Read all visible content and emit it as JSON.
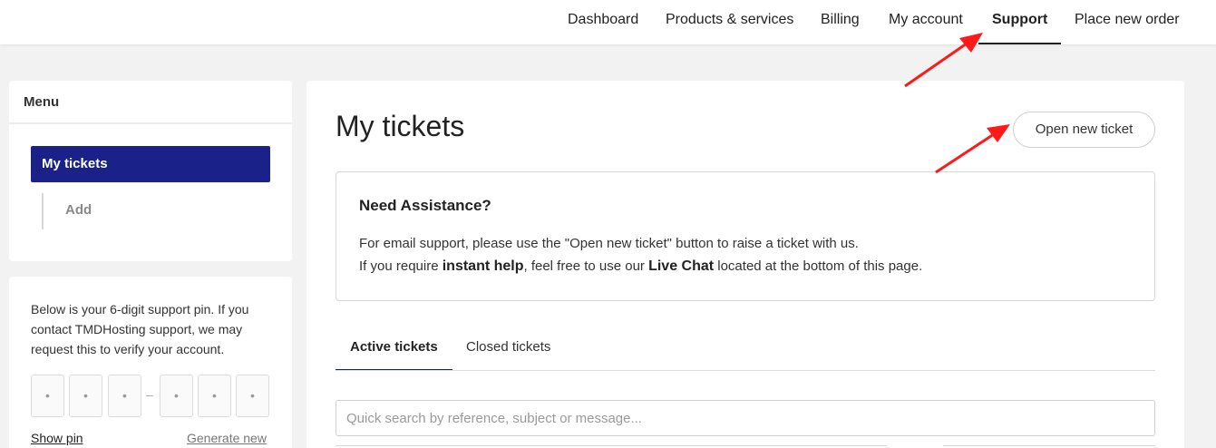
{
  "nav": {
    "items": [
      "Dashboard",
      "Products & services",
      "Billing",
      "My account",
      "Support",
      "Place new order"
    ],
    "active": "Support"
  },
  "sidebar": {
    "menu_title": "Menu",
    "items": [
      {
        "label": "My tickets",
        "active": true
      },
      {
        "label": "Add",
        "active": false
      }
    ]
  },
  "pin": {
    "description": "Below is your 6-digit support pin. If you contact TMDHosting support, we may request this to verify your account.",
    "digits": [
      "•",
      "•",
      "•",
      "•",
      "•",
      "•"
    ],
    "separator": "–",
    "show_label": "Show pin",
    "generate_label": "Generate new"
  },
  "main": {
    "title": "My tickets",
    "open_ticket_label": "Open new ticket",
    "assistance": {
      "title": "Need Assistance?",
      "line1": "For email support, please use the \"Open new ticket\" button to raise a ticket with us.",
      "line2_pre": "If you require ",
      "line2_bold1": "instant help",
      "line2_mid": ", feel free to use our ",
      "line2_bold2": "Live Chat",
      "line2_post": " located at the bottom of this page."
    },
    "tabs": [
      {
        "label": "Active tickets",
        "active": true
      },
      {
        "label": "Closed tickets",
        "active": false
      }
    ],
    "search_placeholder": "Quick search by reference, subject or message..."
  },
  "colors": {
    "accent": "#1a228a",
    "annotation_arrow": "#ff1a1a",
    "background": "#f2f2f2"
  }
}
